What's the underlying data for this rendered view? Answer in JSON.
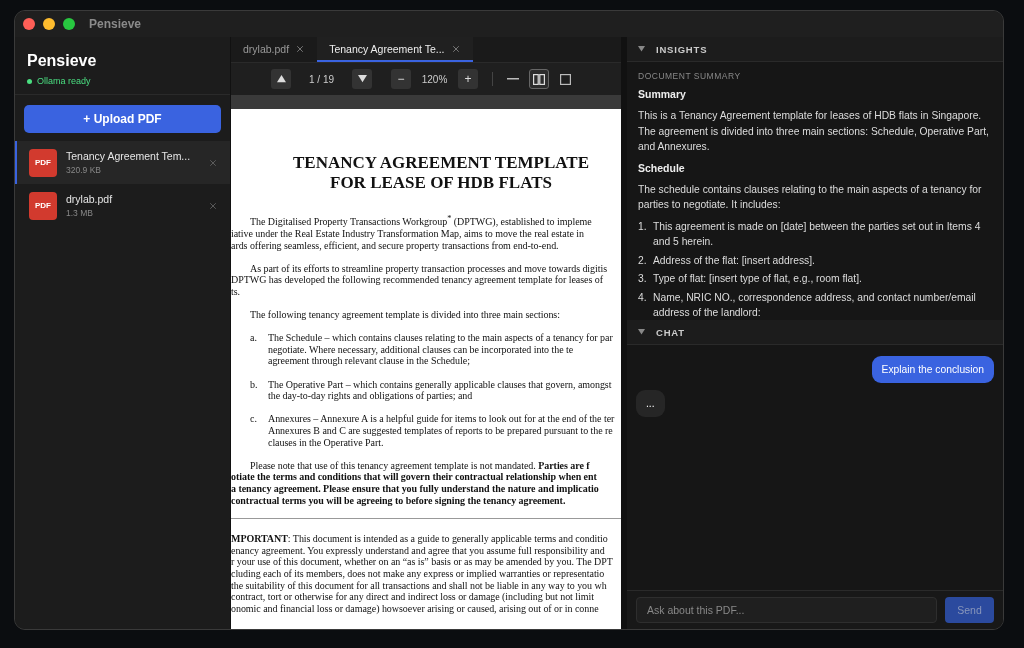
{
  "window": {
    "title": "Pensieve"
  },
  "sidebar": {
    "app_name": "Pensieve",
    "status": "Ollama ready",
    "upload_button": "+ Upload PDF",
    "files": [
      {
        "badge": "PDF",
        "name": "Tenancy Agreement Tem...",
        "size": "320.9 KB",
        "selected": true
      },
      {
        "badge": "PDF",
        "name": "drylab.pdf",
        "size": "1.3 MB",
        "selected": false
      }
    ]
  },
  "tabs": [
    {
      "label": "drylab.pdf",
      "selected": false
    },
    {
      "label": "Tenancy Agreement Te...",
      "selected": true
    }
  ],
  "toolbar": {
    "page": "1 / 19",
    "zoom_out": "−",
    "zoom": "120%",
    "zoom_in": "+",
    "view_modes": [
      {
        "kind": "continuous",
        "selected": false
      },
      {
        "kind": "two-page",
        "selected": true
      },
      {
        "kind": "single",
        "selected": false
      }
    ]
  },
  "document": {
    "title_lines": [
      "TENANCY AGREEMENT TEMPLATE",
      "FOR LEASE OF HDB FLATS"
    ],
    "blocks": [
      {
        "kind": "para",
        "lines": [
          "The Digitalised Property Transactions Workgroup$^{*}$ (DPTWG), established to impleme",
          "iative under the Real Estate Industry Transformation Map, aims to move the real estate in",
          "ards offering seamless, efficient, and secure property transactions from end-to-end."
        ]
      },
      {
        "kind": "para",
        "lines": [
          "As part of its efforts to streamline property transaction processes and move towards digitis",
          "DPTWG has developed the following recommended tenancy agreement template for leases of",
          "ts."
        ]
      },
      {
        "kind": "para",
        "lines": [
          "The following tenancy agreement template is divided into three main sections:"
        ]
      },
      {
        "kind": "item",
        "marker": "a.",
        "lines": [
          "The Schedule – which contains clauses relating to the main aspects of a tenancy for par",
          "negotiate. Where necessary, additional clauses can be incorporated into the te",
          "agreement through relevant clause in the Schedule;"
        ]
      },
      {
        "kind": "item",
        "marker": "b.",
        "lines": [
          "The Operative Part – which contains generally applicable clauses that govern, amongst",
          "the day-to-day rights and obligations of parties; and"
        ]
      },
      {
        "kind": "item",
        "marker": "c.",
        "lines": [
          "Annexures – Annexure A is a helpful guide for items to look out for at the end of the ter",
          "Annexures B and C are suggested templates of reports to be prepared pursuant to the re",
          "clauses in the Operative Part."
        ]
      },
      {
        "kind": "para",
        "lines": [
          "Please note that use of this tenancy agreement template is not mandated. **Parties are f**",
          "**otiate the terms and conditions that will govern their contractual relationship when ent**",
          "**a tenancy agreement. Please ensure that you fully understand the nature and implicatio**",
          "**contractual terms you will be agreeing to before signing the tenancy agreement.**"
        ]
      },
      {
        "kind": "rule"
      },
      {
        "kind": "plain",
        "lines": [
          "**MPORTANT**: This document is intended as a guide to generally applicable terms and conditio",
          "enancy agreement. You expressly understand and agree that you assume full responsibility and",
          "r your use of this document, whether on an “as is” basis or as may be amended by you. The DPT",
          "cluding each of its members, does not make any express or implied warranties or representatio",
          "the suitability of this document for all transactions and shall not be liable in any way to you wh",
          "contract, tort or otherwise for any direct and indirect loss or damage (including but not limit",
          "onomic and financial loss or damage) howsoever arising or caused, arising out of or in conne"
        ]
      }
    ]
  },
  "insights": {
    "title": "INSIGHTS",
    "expanded": true,
    "section_label": "DOCUMENT SUMMARY",
    "content": [
      {
        "kind": "heading",
        "text": "Summary"
      },
      {
        "kind": "paragraph",
        "text": "This is a Tenancy Agreement template for leases of HDB flats in Singapore. The agreement is divided into three main sections: Schedule, Operative Part, and Annexures."
      },
      {
        "kind": "heading",
        "text": "Schedule"
      },
      {
        "kind": "paragraph",
        "text": "The schedule contains clauses relating to the main aspects of a tenancy for parties to negotiate. It includes:"
      },
      {
        "kind": "list",
        "items": [
          {
            "number": "1.",
            "text": "This agreement is made on [date] between the parties set out in Items 4 and 5 herein."
          },
          {
            "number": "2.",
            "text": "Address of the flat: [insert address]."
          },
          {
            "number": "3.",
            "text": "Type of flat: [insert type of flat, e.g., room flat]."
          },
          {
            "number": "4.",
            "text": "Name, NRIC NO., correspondence address, and contact number/email address of the landlord:"
          }
        ]
      }
    ]
  },
  "chat": {
    "title": "CHAT",
    "expanded": true,
    "messages": [
      {
        "kind": "user",
        "text": "Explain the conclusion"
      },
      {
        "kind": "assistant",
        "text": "..."
      }
    ],
    "input": {
      "placeholder": "Ask about this PDF..."
    },
    "send_button": {
      "label": "Send",
      "disabled": true
    }
  }
}
